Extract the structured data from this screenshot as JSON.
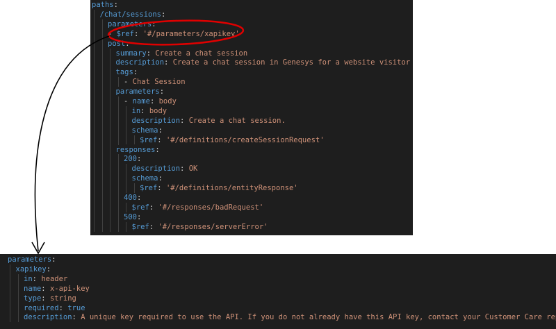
{
  "top_snippet": {
    "lines": [
      {
        "indent": 0,
        "key": "paths",
        "sep": ":",
        "val": "",
        "vclass": "s"
      },
      {
        "indent": 1,
        "key": "/chat/sessions",
        "sep": ":",
        "val": "",
        "vclass": "s"
      },
      {
        "indent": 2,
        "key": "parameters",
        "sep": ":",
        "val": "",
        "vclass": "s"
      },
      {
        "indent": 2,
        "dash": "- ",
        "key": "$ref",
        "sep": ": ",
        "val": "'#/parameters/xapikey'",
        "vclass": "s"
      },
      {
        "indent": 2,
        "key": "post",
        "sep": ":",
        "val": "",
        "vclass": "s"
      },
      {
        "indent": 3,
        "key": "summary",
        "sep": ": ",
        "val": "Create a chat session",
        "vclass": "s"
      },
      {
        "indent": 3,
        "key": "description",
        "sep": ": ",
        "val": "Create a chat session in Genesys for a website visitor or customer",
        "vclass": "s"
      },
      {
        "indent": 3,
        "key": "tags",
        "sep": ":",
        "val": "",
        "vclass": "s"
      },
      {
        "indent": 4,
        "dash": "- ",
        "key": "",
        "sep": "",
        "val": "Chat Session",
        "vclass": "s"
      },
      {
        "indent": 3,
        "key": "parameters",
        "sep": ":",
        "val": "",
        "vclass": "s"
      },
      {
        "indent": 4,
        "dash": "- ",
        "key": "name",
        "sep": ": ",
        "val": "body",
        "vclass": "s"
      },
      {
        "indent": 5,
        "key": "in",
        "sep": ": ",
        "val": "body",
        "vclass": "s"
      },
      {
        "indent": 5,
        "key": "description",
        "sep": ": ",
        "val": "Create a chat session.",
        "vclass": "s"
      },
      {
        "indent": 5,
        "key": "schema",
        "sep": ":",
        "val": "",
        "vclass": "s"
      },
      {
        "indent": 6,
        "key": "$ref",
        "sep": ": ",
        "val": "'#/definitions/createSessionRequest'",
        "vclass": "s"
      },
      {
        "indent": 3,
        "key": "responses",
        "sep": ":",
        "val": "",
        "vclass": "s"
      },
      {
        "indent": 4,
        "key": "200",
        "sep": ":",
        "val": "",
        "vclass": "s"
      },
      {
        "indent": 5,
        "key": "description",
        "sep": ": ",
        "val": "OK",
        "vclass": "s"
      },
      {
        "indent": 5,
        "key": "schema",
        "sep": ":",
        "val": "",
        "vclass": "s"
      },
      {
        "indent": 6,
        "key": "$ref",
        "sep": ": ",
        "val": "'#/definitions/entityResponse'",
        "vclass": "s"
      },
      {
        "indent": 4,
        "key": "400",
        "sep": ":",
        "val": "",
        "vclass": "s"
      },
      {
        "indent": 5,
        "key": "$ref",
        "sep": ": ",
        "val": "'#/responses/badRequest'",
        "vclass": "s"
      },
      {
        "indent": 4,
        "key": "500",
        "sep": ":",
        "val": "",
        "vclass": "s"
      },
      {
        "indent": 5,
        "key": "$ref",
        "sep": ": ",
        "val": "'#/responses/serverError'",
        "vclass": "s"
      }
    ]
  },
  "bottom_snippet": {
    "lines": [
      {
        "indent": 0,
        "key": "parameters",
        "sep": ":",
        "val": "",
        "vclass": "s"
      },
      {
        "indent": 1,
        "key": "xapikey",
        "sep": ":",
        "val": "",
        "vclass": "s"
      },
      {
        "indent": 2,
        "key": "in",
        "sep": ": ",
        "val": "header",
        "vclass": "s"
      },
      {
        "indent": 2,
        "key": "name",
        "sep": ": ",
        "val": "x-api-key",
        "vclass": "s"
      },
      {
        "indent": 2,
        "key": "type",
        "sep": ": ",
        "val": "string",
        "vclass": "s"
      },
      {
        "indent": 2,
        "key": "required",
        "sep": ": ",
        "val": "true",
        "vclass": "k"
      },
      {
        "indent": 2,
        "key": "description",
        "sep": ": ",
        "val": "A unique key required to use the API. If you do not already have this API key, contact your Customer Care representative.",
        "vclass": "s"
      }
    ]
  },
  "colors": {
    "editor_bg": "#1e1e1e",
    "key": "#569cd6",
    "string": "#ce9178",
    "annotation": "#e00000",
    "arrow": "#000000"
  },
  "annotations": {
    "highlight": "red-ellipse-around-ref",
    "connector": "curved-arrow-to-parameters-definition"
  }
}
